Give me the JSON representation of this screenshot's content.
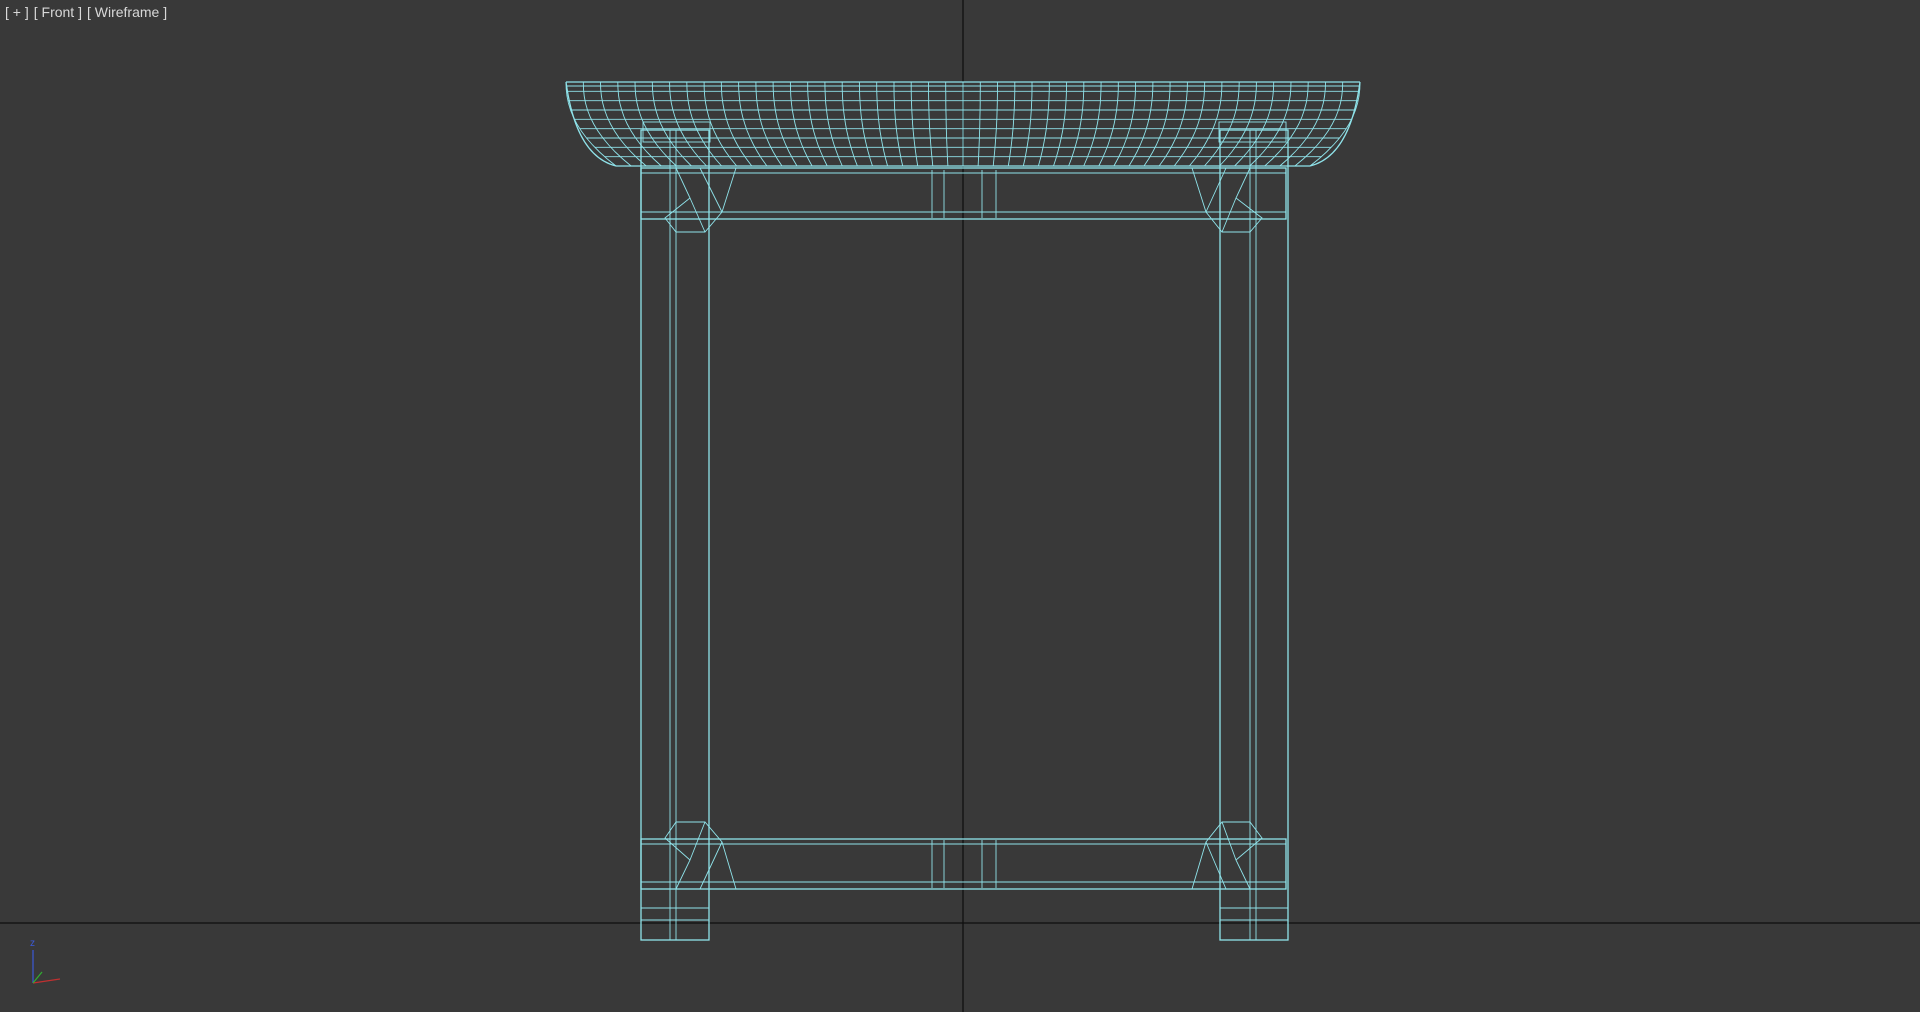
{
  "viewport": {
    "menu_label": "[ + ]",
    "view_label": "[ Front ]",
    "shading_label": "[ Wireframe ]"
  },
  "gizmo": {
    "z_label": "z",
    "z_color": "#3c5ad8",
    "x_color": "#c03030",
    "y_color": "#30b030"
  },
  "colors": {
    "background": "#393939",
    "wireframe": "#8fe3ea",
    "axis": "#0e0e0e"
  },
  "object": {
    "icon": "wireframe-table-model"
  }
}
